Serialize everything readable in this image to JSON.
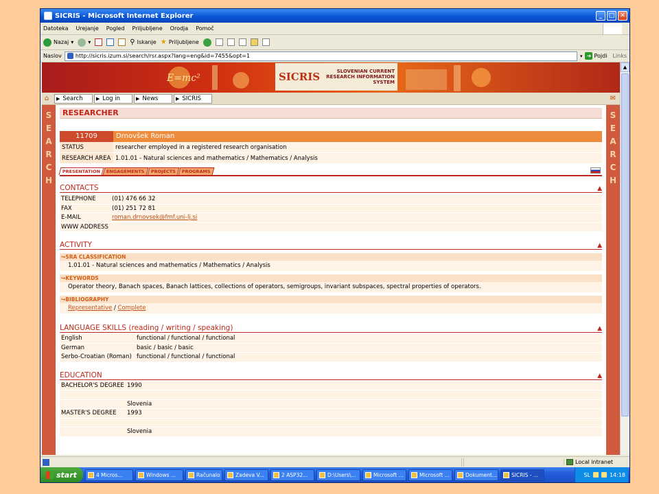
{
  "window": {
    "title": "SICRIS - Microsoft Internet Explorer"
  },
  "menu": [
    "Datoteka",
    "Urejanje",
    "Pogled",
    "Priljubljene",
    "Orodja",
    "Pomoč"
  ],
  "toolbar": {
    "back": "Nazaj",
    "search": "Iskanje",
    "favorites": "Priljubljene"
  },
  "address": {
    "label": "Naslov",
    "url": "http://sicris.izum.si/search/rsr.aspx?lang=eng&id=7455&opt=1",
    "go": "Pojdi",
    "links": "Links"
  },
  "banner": {
    "logo_mark": "SICRIS",
    "logo_text": "SLOVENIAN CURRENT RESEARCH INFORMATION SYSTEM"
  },
  "nav": [
    "Search",
    "Log in",
    "News",
    "SICRIS"
  ],
  "sidebar_letters": [
    "S",
    "E",
    "A",
    "R",
    "C",
    "H"
  ],
  "page": {
    "heading": "RESEARCHER",
    "id": "11709",
    "name": "Drnovšek Roman",
    "status_label": "STATUS",
    "status": "researcher employed in a registered research organisation",
    "area_label": "RESEARCH AREA",
    "area": "1.01.01 - Natural sciences and mathematics / Mathematics / Analysis",
    "tabs": [
      "PRESENTATION",
      "ENGAGEMENTS",
      "PROJECTS",
      "PROGRAMS"
    ]
  },
  "contacts": {
    "title": "CONTACTS",
    "rows": [
      {
        "k": "TELEPHONE",
        "v": "(01) 476 66 32"
      },
      {
        "k": "FAX",
        "v": "(01) 251 72 81"
      },
      {
        "k": "E-MAIL",
        "v": "roman.drnovsek@fmf.uni-lj.si"
      },
      {
        "k": "WWW ADDRESS",
        "v": ""
      }
    ]
  },
  "activity": {
    "title": "ACTIVITY",
    "sra_title": "SRA CLASSIFICATION",
    "sra": "1.01.01 - Natural sciences and mathematics / Mathematics / Analysis",
    "keywords_title": "KEYWORDS",
    "keywords": "Operator theory, Banach spaces, Banach lattices, collections of operators, semigroups, invariant subspaces, spectral properties of operators.",
    "biblio_title": "BIBLIOGRAPHY",
    "biblio_representative": "Representative",
    "biblio_sep": "/",
    "biblio_complete": "Complete"
  },
  "languages": {
    "title": "LANGUAGE SKILLS (reading / writing / speaking)",
    "rows": [
      {
        "k": "English",
        "v": "functional / functional / functional"
      },
      {
        "k": "German",
        "v": "basic / basic / basic"
      },
      {
        "k": "Serbo-Croatian (Roman)",
        "v": "functional / functional / functional"
      }
    ]
  },
  "education": {
    "title": "EDUCATION",
    "rows": [
      {
        "k": "BACHELOR'S DEGREE",
        "v": "1990"
      },
      {
        "k": "",
        "v": ""
      },
      {
        "k": "",
        "v": "Slovenia"
      },
      {
        "k": "MASTER'S DEGREE",
        "v": "1993"
      },
      {
        "k": "",
        "v": ""
      },
      {
        "k": "",
        "v": "Slovenia"
      }
    ]
  },
  "status": {
    "zone": "Local intranet"
  },
  "taskbar": {
    "start": "start",
    "tasks": [
      "4 Micros...",
      "Windows ...",
      "Računalo",
      "Zadeva V...",
      "2 ASP32...",
      "D:\\Users\\...",
      "Microsoft ...",
      "Microsoft ...",
      "Dokument...",
      "SICRIS - ..."
    ],
    "lang": "SL",
    "time": "14:18"
  }
}
